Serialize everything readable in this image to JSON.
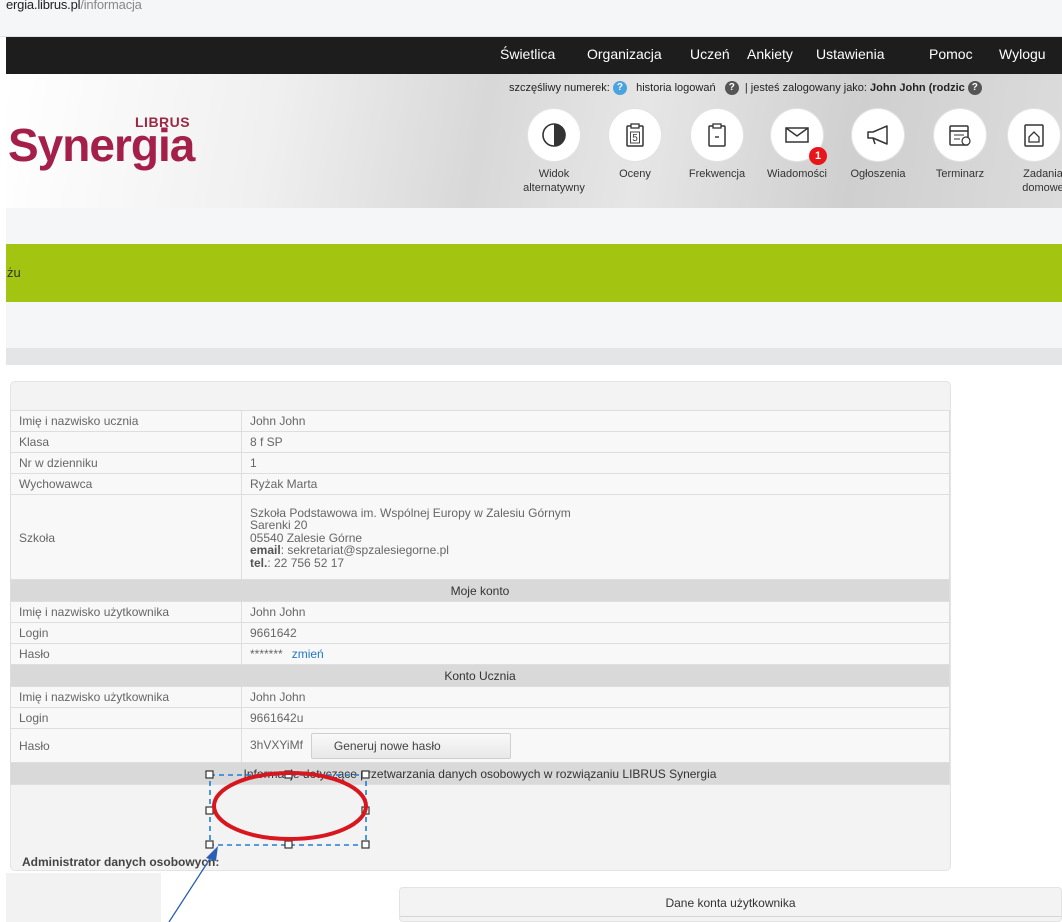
{
  "browser": {
    "url_host": "ergia.librus.pl",
    "url_path": "/informacja"
  },
  "topnav": {
    "items": [
      "Świetlica",
      "Organizacja",
      "Uczeń",
      "Ankiety",
      "Ustawienia",
      "Pomoc",
      "Wylogu"
    ]
  },
  "header": {
    "logo_top": "LIBRUS",
    "logo_main": "Synergia",
    "lucky_number_label": "szczęśliwy numerek:",
    "login_history_label": "historia logowań",
    "logged_in_label": "| jesteś zalogowany jako:",
    "logged_in_user": "John John (rodzic",
    "help_glyph": "?",
    "message_badge": "1",
    "shortcuts": [
      {
        "label": "Widok alternatywny",
        "icon": "half-circle-icon"
      },
      {
        "label": "Oceny",
        "icon": "grades-clipboard-icon"
      },
      {
        "label": "Frekwencja",
        "icon": "attendance-clipboard-icon"
      },
      {
        "label": "Wiadomości",
        "icon": "envelope-icon"
      },
      {
        "label": "Ogłoszenia",
        "icon": "megaphone-icon"
      },
      {
        "label": "Terminarz",
        "icon": "calendar-icon"
      },
      {
        "label": "Zadania domowe",
        "icon": "homework-icon"
      }
    ]
  },
  "greenbar": {
    "title": "żu"
  },
  "student": {
    "name_label": "Imię i nazwisko ucznia",
    "name": "John John",
    "class_label": "Klasa",
    "class": "8 f SP",
    "number_label": "Nr w dzienniku",
    "number": "1",
    "tutor_label": "Wychowawca",
    "tutor": "Ryżak Marta",
    "school_label": "Szkoła",
    "school_name": "Szkoła Podstawowa im. Wspólnej Europy w Zalesiu Górnym",
    "school_street": "Sarenki 20",
    "school_city": "05540 Zalesie Górne",
    "email_label": "email",
    "email": ": sekretariat@spzalesiegorne.pl",
    "tel_label": "tel.",
    "tel": ": 22 756 52 17"
  },
  "my_account": {
    "header": "Moje konto",
    "name_label": "Imię i nazwisko użytkownika",
    "name": "John John",
    "login_label": "Login",
    "login": "9661642",
    "password_label": "Hasło",
    "password": "*******",
    "change_link": "zmień"
  },
  "student_account": {
    "header": "Konto Ucznia",
    "name_label": "Imię i nazwisko użytkownika",
    "name": "John John",
    "login_label": "Login",
    "login": "9661642u",
    "password_label": "Hasło",
    "password": "3hVXYiMf",
    "generate_button": "Generuj nowe hasło"
  },
  "gdpr": {
    "header": "Informacje dotyczące przetwarzania danych osobowych w rozwiązaniu LIBRUS Synergia",
    "admin_label": "Administrator danych osobowych:"
  },
  "bottom_panel": {
    "header": "Dane konta użytkownika"
  },
  "colors": {
    "nav_bg": "#1d1d1d",
    "green_bar": "#a3c511",
    "brand": "#a4204a",
    "badge": "#e8151a",
    "annotation": "#1f7fd6",
    "ellipse": "#d8161e"
  }
}
